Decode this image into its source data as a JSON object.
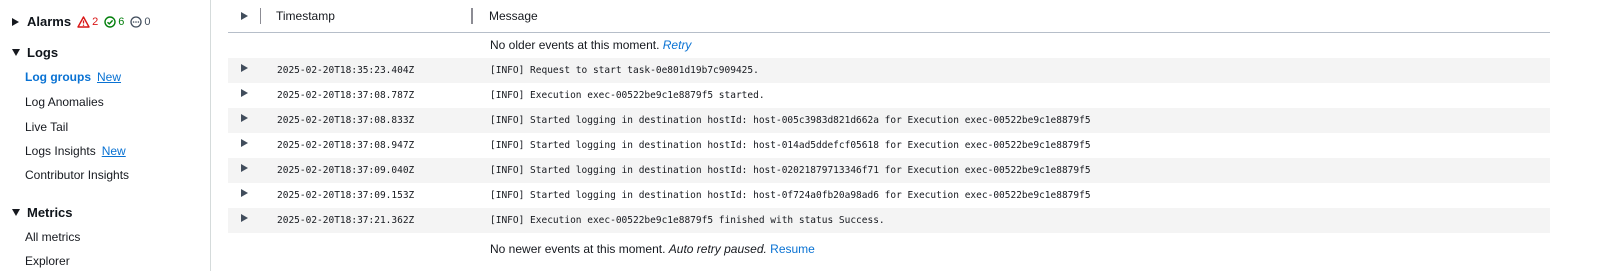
{
  "sidebar": {
    "alarms": {
      "label": "Alarms",
      "alarm_count": "2",
      "ok_count": "6",
      "insufficient_count": "0"
    },
    "logs": {
      "label": "Logs",
      "items": [
        {
          "label": "Log groups",
          "tag": "New"
        },
        {
          "label": "Log Anomalies"
        },
        {
          "label": "Live Tail"
        },
        {
          "label": "Logs Insights",
          "tag": "New"
        },
        {
          "label": "Contributor Insights"
        }
      ]
    },
    "metrics": {
      "label": "Metrics",
      "items": [
        {
          "label": "All metrics"
        },
        {
          "label": "Explorer"
        }
      ]
    }
  },
  "table": {
    "columns": {
      "timestamp": "Timestamp",
      "message": "Message"
    },
    "older_notice": {
      "text": "No older events at this moment.",
      "link": "Retry"
    },
    "rows": [
      {
        "timestamp": "2025-02-20T18:35:23.404Z",
        "message": "[INFO] Request to start task-0e801d19b7c909425."
      },
      {
        "timestamp": "2025-02-20T18:37:08.787Z",
        "message": "[INFO] Execution exec-00522be9c1e8879f5 started."
      },
      {
        "timestamp": "2025-02-20T18:37:08.833Z",
        "message": "[INFO] Started logging in destination hostId: host-005c3983d821d662a for Execution exec-00522be9c1e8879f5"
      },
      {
        "timestamp": "2025-02-20T18:37:08.947Z",
        "message": "[INFO] Started logging in destination hostId: host-014ad5ddefcf05618 for Execution exec-00522be9c1e8879f5"
      },
      {
        "timestamp": "2025-02-20T18:37:09.040Z",
        "message": "[INFO] Started logging in destination hostId: host-02021879713346f71 for Execution exec-00522be9c1e8879f5"
      },
      {
        "timestamp": "2025-02-20T18:37:09.153Z",
        "message": "[INFO] Started logging in destination hostId: host-0f724a0fb20a98ad6 for Execution exec-00522be9c1e8879f5"
      },
      {
        "timestamp": "2025-02-20T18:37:21.362Z",
        "message": "[INFO] Execution exec-00522be9c1e8879f5 finished with status Success."
      }
    ],
    "newer_notice": {
      "text": "No newer events at this moment.",
      "italic": "Auto retry paused.",
      "link": "Resume"
    }
  },
  "colors": {
    "link": "#0972d3",
    "alarm": "#d91515",
    "ok": "#037f0c",
    "neutral": "#414d5c"
  }
}
